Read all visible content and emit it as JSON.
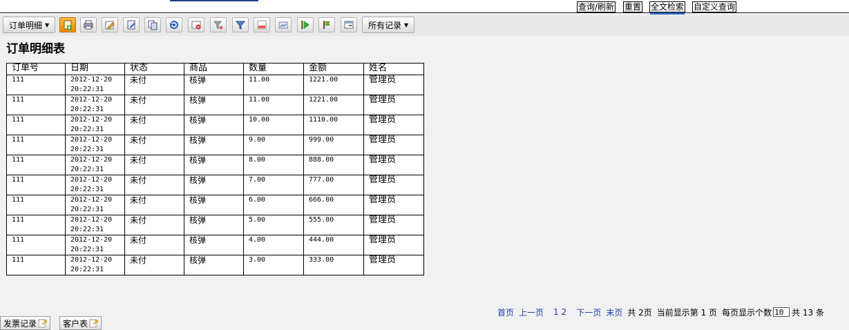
{
  "top_links": [
    {
      "label": "查询/刷新"
    },
    {
      "label": "重置"
    },
    {
      "label": "全文检索"
    },
    {
      "label": "自定义查询"
    }
  ],
  "toolbar": {
    "table_menu_label": "订单明细",
    "filter_menu_label": "所有记录",
    "buttons": [
      {
        "icon": "add-record-icon"
      },
      {
        "icon": "print-icon"
      },
      {
        "icon": "edit-icon"
      },
      {
        "icon": "batch-edit-icon"
      },
      {
        "icon": "copy-icon"
      },
      {
        "icon": "refresh-icon"
      },
      {
        "icon": "delete-icon"
      },
      {
        "icon": "clear-filter-icon"
      },
      {
        "icon": "filter-icon"
      },
      {
        "icon": "export-icon"
      },
      {
        "icon": "import-icon"
      },
      {
        "icon": "run-icon"
      },
      {
        "icon": "flag-icon"
      },
      {
        "icon": "window-icon"
      }
    ]
  },
  "page_title": "订单明细表",
  "table": {
    "headers": [
      "订单号",
      "日期",
      "状态",
      "商品",
      "数量",
      "金额",
      "姓名"
    ],
    "rows": [
      {
        "order_no": "111",
        "date": "2012-12-20",
        "time": "20:22:31",
        "status": "未付",
        "product": "核弹",
        "qty": "11.00",
        "amount": "1221.00",
        "name": "管理员"
      },
      {
        "order_no": "111",
        "date": "2012-12-20",
        "time": "20:22:31",
        "status": "未付",
        "product": "核弹",
        "qty": "11.00",
        "amount": "1221.00",
        "name": "管理员"
      },
      {
        "order_no": "111",
        "date": "2012-12-20",
        "time": "20:22:31",
        "status": "未付",
        "product": "核弹",
        "qty": "10.00",
        "amount": "1110.00",
        "name": "管理员"
      },
      {
        "order_no": "111",
        "date": "2012-12-20",
        "time": "20:22:31",
        "status": "未付",
        "product": "核弹",
        "qty": "9.00",
        "amount": "999.00",
        "name": "管理员"
      },
      {
        "order_no": "111",
        "date": "2012-12-20",
        "time": "20:22:31",
        "status": "未付",
        "product": "核弹",
        "qty": "8.00",
        "amount": "888.00",
        "name": "管理员"
      },
      {
        "order_no": "111",
        "date": "2012-12-20",
        "time": "20:22:31",
        "status": "未付",
        "product": "核弹",
        "qty": "7.00",
        "amount": "777.00",
        "name": "管理员"
      },
      {
        "order_no": "111",
        "date": "2012-12-20",
        "time": "20:22:31",
        "status": "未付",
        "product": "核弹",
        "qty": "6.00",
        "amount": "666.00",
        "name": "管理员"
      },
      {
        "order_no": "111",
        "date": "2012-12-20",
        "time": "20:22:31",
        "status": "未付",
        "product": "核弹",
        "qty": "5.00",
        "amount": "555.00",
        "name": "管理员"
      },
      {
        "order_no": "111",
        "date": "2012-12-20",
        "time": "20:22:31",
        "status": "未付",
        "product": "核弹",
        "qty": "4.00",
        "amount": "444.00",
        "name": "管理员"
      },
      {
        "order_no": "111",
        "date": "2012-12-20",
        "time": "20:22:31",
        "status": "未付",
        "product": "核弹",
        "qty": "3.00",
        "amount": "333.00",
        "name": "管理员"
      }
    ]
  },
  "pager": {
    "first": "首页",
    "prev": "上一页",
    "page1": "1",
    "page2": "2",
    "next": "下一页",
    "last": "末页",
    "total_pages_text": "共 2页",
    "current_page_text": "当前显示第 1 页",
    "page_size_label": "每页显示个数",
    "page_size_value": "10",
    "total_records_text": "共 13 条"
  },
  "bottom_tabs": [
    {
      "label": "发票记录"
    },
    {
      "label": "客户表"
    }
  ]
}
